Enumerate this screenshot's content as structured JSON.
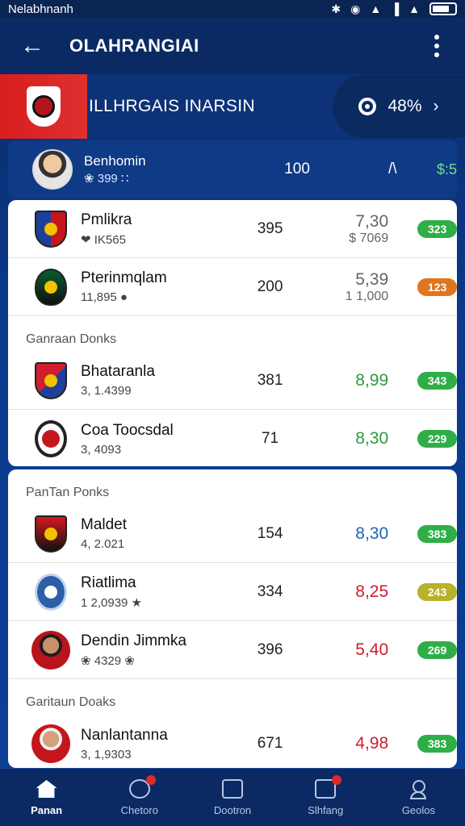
{
  "status_bar": {
    "carrier": "Nelabhnanh"
  },
  "app_bar": {
    "title": "OLAHRANGIAI"
  },
  "league": {
    "name": "ILLHRGAIS INARSIN",
    "pill_value": "48%"
  },
  "pinned": {
    "name": "Benhomin",
    "sub": "❀ 399 ∷",
    "score": "100",
    "mid": "/\\",
    "value": "$:5"
  },
  "card1": {
    "rows": [
      {
        "name": "Pmlikra",
        "sub": "❤ IK565",
        "score": "395",
        "odds_top": "7,30",
        "odds_bottom": "$ 7069",
        "pill": "323",
        "pill_color": "green"
      },
      {
        "name": "Pterinmqlam",
        "sub": "11,895 ●",
        "score": "200",
        "odds_top": "5,39",
        "odds_bottom": "1 1,000",
        "pill": "123",
        "pill_color": "orange"
      }
    ],
    "section_label": "Ganraan Donks",
    "rows2": [
      {
        "name": "Bhataranla",
        "sub": "3, 1.4399",
        "score": "381",
        "odds": "8,99",
        "odds_color": "green",
        "pill": "343",
        "pill_color": "green"
      },
      {
        "name": "Coa Toocsdal",
        "sub": "3, 4093",
        "score": "71",
        "odds": "8,30",
        "odds_color": "green",
        "pill": "229",
        "pill_color": "green"
      }
    ]
  },
  "card2": {
    "section_label": "PanTan Ponks",
    "rows": [
      {
        "name": "Maldet",
        "sub": "4, 2.021",
        "score": "154",
        "odds": "8,30",
        "odds_color": "blue",
        "pill": "383",
        "pill_color": "green"
      },
      {
        "name": "Riatlima",
        "sub": "1 2,0939 ★",
        "score": "334",
        "odds": "8,25",
        "odds_color": "red",
        "pill": "243",
        "pill_color": "olive"
      },
      {
        "name": "Dendin Jimmka",
        "sub": "❀ 4329 ❀",
        "score": "396",
        "odds": "5,40",
        "odds_color": "red",
        "pill": "269",
        "pill_color": "green"
      }
    ],
    "section_label2": "Garitaun Doaks",
    "rows2": [
      {
        "name": "Nanlantanna",
        "sub": "3, 1,9303",
        "score": "671",
        "odds": "4,98",
        "odds_color": "red",
        "pill": "383",
        "pill_color": "green"
      }
    ]
  },
  "nav": {
    "items": [
      {
        "label": "Panan",
        "icon": "home-icon"
      },
      {
        "label": "Chetoro",
        "icon": "shield-icon"
      },
      {
        "label": "Dootron",
        "icon": "card-icon"
      },
      {
        "label": "Slhfang",
        "icon": "news-icon"
      },
      {
        "label": "Geolos",
        "icon": "user-icon"
      }
    ]
  }
}
